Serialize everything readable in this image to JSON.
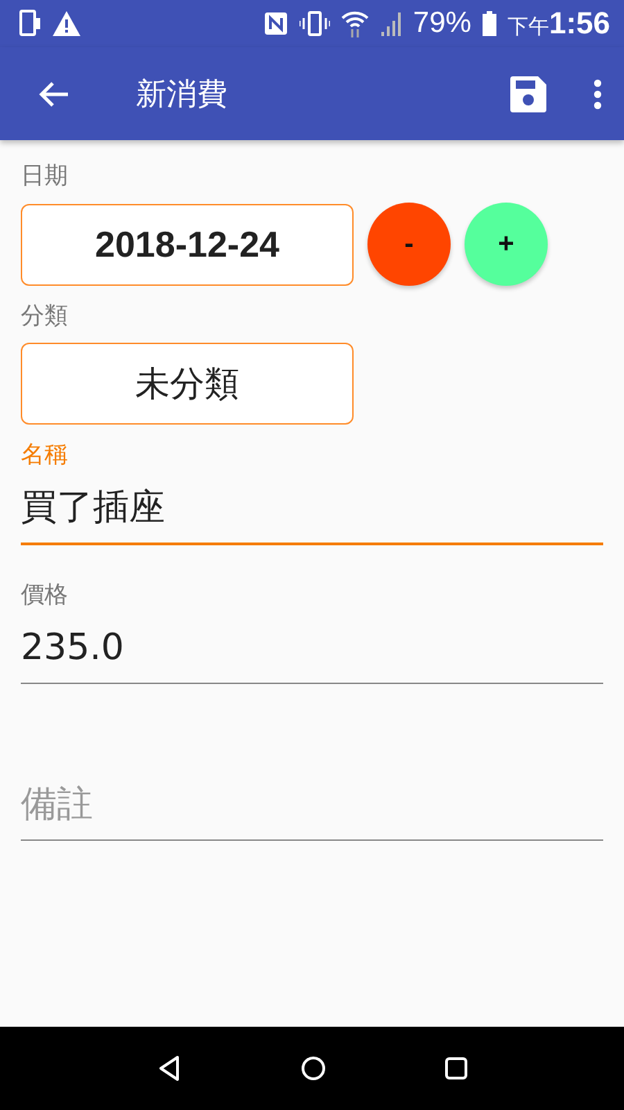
{
  "status_bar": {
    "battery": "79%",
    "time_prefix": "下午",
    "time": "1:56"
  },
  "toolbar": {
    "title": "新消費"
  },
  "fields": [
    {
      "kind": "date",
      "label": "日期",
      "value": "2018-12-24",
      "buttons": [
        "-",
        "+"
      ]
    },
    {
      "kind": "box",
      "label": "分類",
      "value": "未分類"
    },
    {
      "kind": "text",
      "label": "名稱",
      "value": "買了插座",
      "focused": true
    },
    {
      "kind": "text",
      "label": "價格",
      "value": "235.0",
      "focused": false
    },
    {
      "kind": "text",
      "placeholder": "備註",
      "focused": false
    }
  ]
}
